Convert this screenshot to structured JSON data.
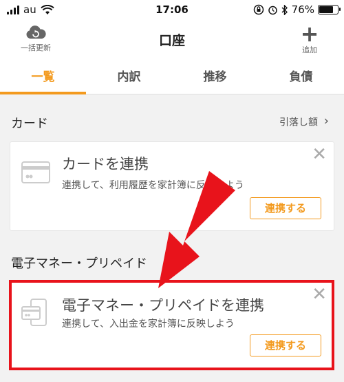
{
  "status_bar": {
    "carrier": "au",
    "time": "17:06",
    "battery_text": "76%",
    "battery_level": 0.76
  },
  "nav": {
    "left_label": "一括更新",
    "title": "口座",
    "right_label": "追加"
  },
  "tabs": [
    {
      "label": "一覧",
      "active": true
    },
    {
      "label": "内訳",
      "active": false
    },
    {
      "label": "推移",
      "active": false
    },
    {
      "label": "負債",
      "active": false
    }
  ],
  "card_section": {
    "title": "カード",
    "link": "引落し額",
    "card": {
      "title": "カードを連携",
      "description": "連携して、利用履歴を家計簿に反映しよう",
      "button": "連携する"
    }
  },
  "emoney_section": {
    "title": "電子マネー・プリペイド",
    "card": {
      "title": "電子マネー・プリペイドを連携",
      "description": "連携して、入出金を家計簿に反映しよう",
      "button": "連携する"
    }
  },
  "colors": {
    "accent": "#f39a1e",
    "highlight": "#e8131b"
  }
}
